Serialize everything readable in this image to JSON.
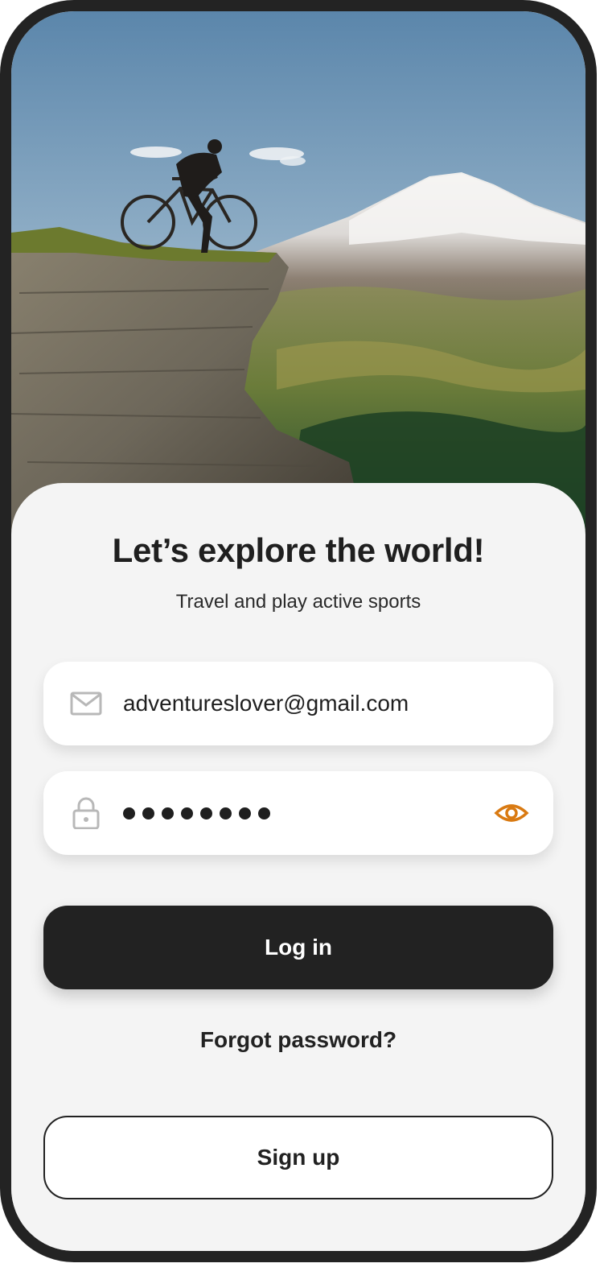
{
  "hero": {
    "image_subject": "cyclist-on-cliff-mountain-landscape"
  },
  "header": {
    "title": "Let’s explore the world!",
    "subtitle": "Travel and play active sports"
  },
  "form": {
    "email_icon": "mail-icon",
    "email_value": "adventureslover@gmail.com",
    "password_icon": "lock-icon",
    "password_masked_length": 8,
    "password_toggle_icon": "eye-icon"
  },
  "actions": {
    "login_label": "Log in",
    "forgot_label": "Forgot password?",
    "signup_label": "Sign up"
  },
  "colors": {
    "accent": "#d97a12",
    "primary_button": "#222222",
    "sheet_background": "#f4f4f4",
    "icon_gray": "#b8b8b8"
  }
}
